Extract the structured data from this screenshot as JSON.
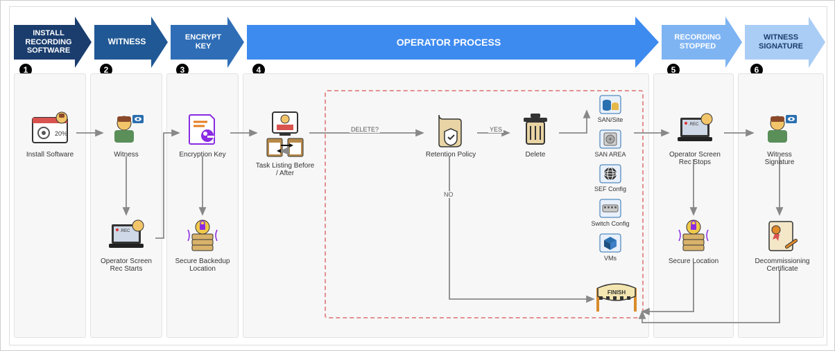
{
  "steps": {
    "s1": {
      "num": "1",
      "label": "INSTALL RECORDING SOFTWARE"
    },
    "s2": {
      "num": "2",
      "label": "WITNESS"
    },
    "s3": {
      "num": "3",
      "label": "ENCRYPT KEY"
    },
    "s4": {
      "num": "4",
      "label": "OPERATOR PROCESS"
    },
    "s5": {
      "num": "5",
      "label": "RECORDING STOPPED"
    },
    "s6": {
      "num": "6",
      "label": "WITNESS SIGNATURE"
    }
  },
  "nodes": {
    "install_software": "Install Software",
    "install_pct": "20%",
    "witness": "Witness",
    "screen_rec_starts": "Operator Screen Rec Starts",
    "encryption_key": "Encryption Key",
    "secure_backedup": "Secure Backedup Location",
    "task_listing": "Task Listing Before / After",
    "retention_policy": "Retention Policy",
    "delete": "Delete",
    "san_site": "SAN/Site",
    "san_area": "SAN AREA",
    "sef_config": "SEF Config",
    "switch_config": "Switch Config",
    "vms": "VMs",
    "finish": "FINISH",
    "screen_rec_stops": "Operator Screen Rec Stops",
    "secure_location": "Secure Location",
    "witness_signature": "Witness Signature",
    "decom_cert": "Decommissioning Certificate"
  },
  "edge_labels": {
    "delete_q": "DELETE?",
    "yes": "YES",
    "no": "NO"
  },
  "rec_badge": ".REC"
}
